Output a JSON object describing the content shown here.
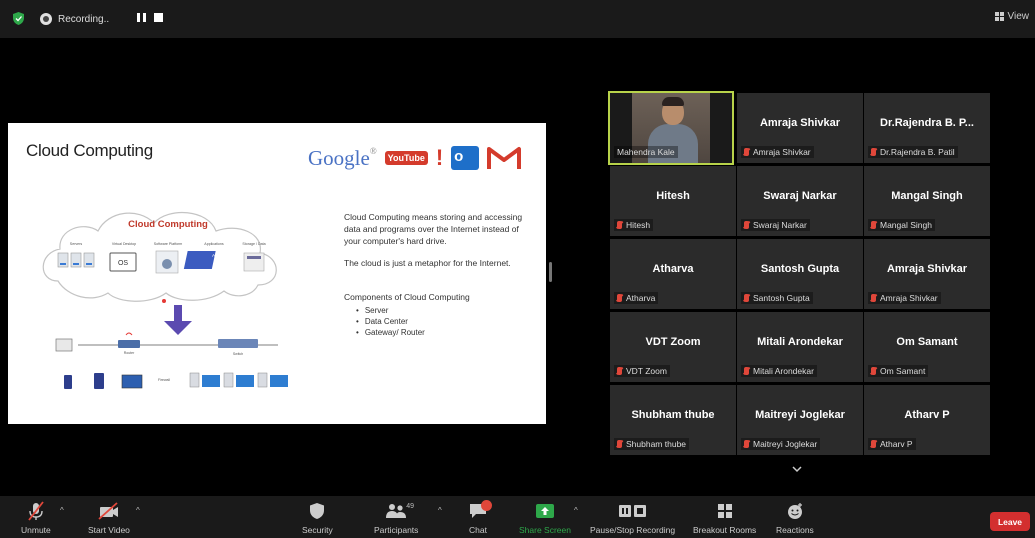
{
  "topbar": {
    "recording_label": "Recording..",
    "view_label": "View"
  },
  "slide": {
    "title": "Cloud Computing",
    "diagram_title": "Cloud Computing",
    "diagram_items": [
      "Servers",
      "Virtual Desktop",
      "Software Platform",
      "Applications",
      "Storage / Data"
    ],
    "diagram_os_label": "OS",
    "diagram_apps_label": "APPS",
    "diagram_router_label": "Router",
    "diagram_switch_label": "Switch",
    "diagram_firewall_label": "Firewall",
    "logo_google": "Google",
    "logo_youtube": "YouTube",
    "logo_yahoo": "!",
    "paragraph1": "Cloud Computing means storing and accessing data and programs over the Internet instead of your computer's hard drive.",
    "paragraph2": "The cloud is just a metaphor for the Internet.",
    "components_title": "Components of Cloud Computing",
    "components": [
      "Server",
      "Data Center",
      "Gateway/ Router"
    ]
  },
  "participants": [
    {
      "name": "Mahendra Kale",
      "label": "Mahendra Kale",
      "video": true
    },
    {
      "name": "Amraja Shivkar",
      "label": "Amraja Shivkar"
    },
    {
      "name": "Dr.Rajendra B. P...",
      "label": "Dr.Rajendra B. Patil"
    },
    {
      "name": "Hitesh",
      "label": "Hitesh"
    },
    {
      "name": "Swaraj Narkar",
      "label": "Swaraj Narkar"
    },
    {
      "name": "Mangal Singh",
      "label": "Mangal Singh"
    },
    {
      "name": "Atharva",
      "label": "Atharva"
    },
    {
      "name": "Santosh Gupta",
      "label": "Santosh Gupta"
    },
    {
      "name": "Amraja Shivkar",
      "label": "Amraja Shivkar"
    },
    {
      "name": "VDT Zoom",
      "label": "VDT Zoom"
    },
    {
      "name": "Mitali Arondekar",
      "label": "Mitali Arondekar"
    },
    {
      "name": "Om Samant",
      "label": "Om Samant"
    },
    {
      "name": "Shubham thube",
      "label": "Shubham thube"
    },
    {
      "name": "Maitreyi Joglekar",
      "label": "Maitreyi Joglekar"
    },
    {
      "name": "Atharv P",
      "label": "Atharv P"
    }
  ],
  "toolbar": {
    "unmute": "Unmute",
    "start_video": "Start Video",
    "security": "Security",
    "participants": "Participants",
    "participant_count": "49",
    "chat": "Chat",
    "share_screen": "Share Screen",
    "pause_stop_recording": "Pause/Stop Recording",
    "breakout_rooms": "Breakout Rooms",
    "reactions": "Reactions",
    "leave": "Leave"
  },
  "colors": {
    "active_speaker_border": "#b8d34a",
    "share_green": "#2ea84a",
    "leave_red": "#d32f2f",
    "muted_red": "#e0473a"
  }
}
